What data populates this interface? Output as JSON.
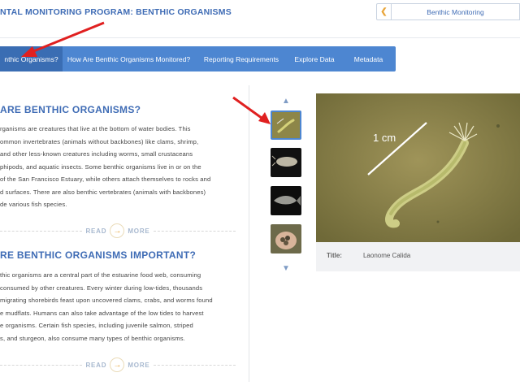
{
  "header": {
    "program_title": "NTAL MONITORING PROGRAM: BENTHIC ORGANISMS",
    "dropdown_label": "Benthic Monitoring"
  },
  "tabs": [
    {
      "label": "nthic Organisms?",
      "active": true
    },
    {
      "label": "How Are Benthic Organisms Monitored?",
      "active": false
    },
    {
      "label": "Reporting Requirements",
      "active": false
    },
    {
      "label": "Explore Data",
      "active": false
    },
    {
      "label": "Metadata",
      "active": false
    }
  ],
  "sections": [
    {
      "heading": "ARE BENTHIC ORGANISMS?",
      "lines": [
        "rganisms are creatures that live at the bottom of water bodies. This",
        "ommon invertebrates (animals without backbones) like clams, shrimp,",
        "and other less-known creatures including worms, small crustaceans",
        "phipods, and aquatic insects. Some benthic organisms live in or on the",
        "of the San Francisco Estuary, while others attach themselves to rocks and",
        "d surfaces. There are also benthic vertebrates (animals with backbones)",
        "de various fish species."
      ],
      "read_label": "READ",
      "more_label": "MORE"
    },
    {
      "heading": "RE BENTHIC ORGANISMS IMPORTANT?",
      "lines": [
        "thic organisms are a central part of the estuarine food web, consuming",
        "consumed by other creatures. Every winter during low-tides, thousands",
        "migrating shorebirds feast upon uncovered clams, crabs, and worms found",
        "e mudflats. Humans can also take advantage of the low tides to harvest",
        "e organisms. Certain fish species, including juvenile salmon, striped",
        "s, and sturgeon, also consume many types of benthic organisms."
      ],
      "read_label": "READ",
      "more_label": "MORE"
    }
  ],
  "gallery": {
    "photo_scale_label": "1 cm",
    "caption_key": "Title:",
    "caption_value": "Laonome Calida",
    "icons": {
      "up": "chevron-up-icon",
      "down": "chevron-down-icon",
      "more": "arrow-right-icon"
    }
  },
  "colors": {
    "brand_blue": "#3f6cb5",
    "tab_bar": "#4d86d1",
    "accent_orange": "#e8a53a",
    "annotation_red": "#e02020"
  }
}
